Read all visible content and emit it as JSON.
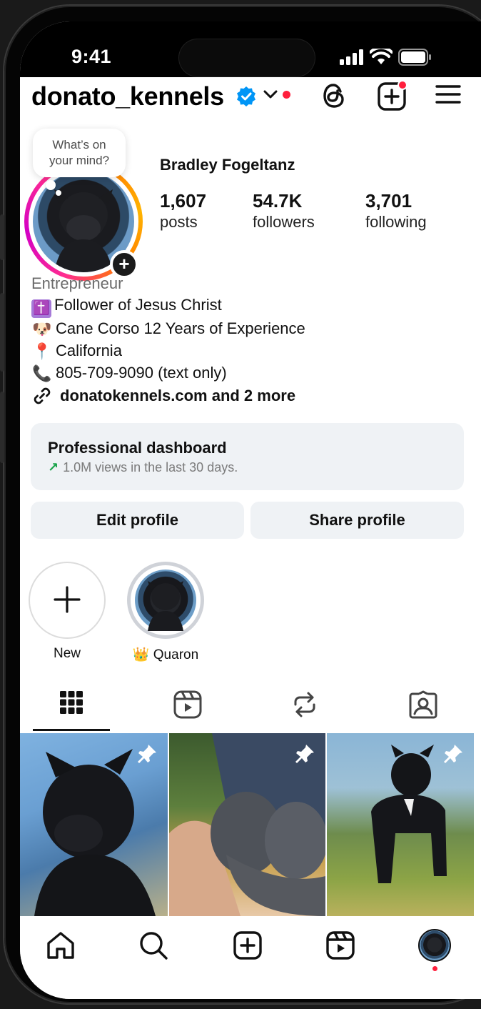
{
  "status_bar": {
    "time": "9:41"
  },
  "header": {
    "username": "donato_kennels"
  },
  "profile": {
    "note_line1": "What’s on",
    "note_line2": "your mind?",
    "full_name": "Bradley Fogeltanz",
    "stats": [
      {
        "value": "1,607",
        "label": "posts"
      },
      {
        "value": "54.7K",
        "label": "followers"
      },
      {
        "value": "3,701",
        "label": "following"
      }
    ],
    "category": "Entrepreneur",
    "bio_lines": [
      {
        "emoji": "✝️",
        "text": "Follower of Jesus Christ"
      },
      {
        "emoji": "🐶",
        "text": "Cane Corso 12 Years of Experience"
      },
      {
        "emoji": "📍",
        "text": "California"
      },
      {
        "emoji": "📞",
        "text": "805-709-9090 (text only)"
      }
    ],
    "link": "donatokennels.com and 2 more"
  },
  "dashboard": {
    "title": "Professional dashboard",
    "arrow": "↗",
    "subtitle": "1.0M views in the last 30 days."
  },
  "buttons": {
    "edit": "Edit profile",
    "share": "Share profile"
  },
  "highlights": {
    "new_label": "New",
    "story_emoji": "👑",
    "story_label": "Quaron"
  },
  "colors": {
    "accent_blue": "#0095f6",
    "notification_red": "#ff1f3d",
    "button_bg": "#eff2f5",
    "trend_green": "#1aa34a"
  },
  "icons": {
    "header": [
      "verified-icon",
      "chevron-down-icon",
      "threads-icon",
      "new-post-icon",
      "menu-icon"
    ],
    "tabs": [
      "grid-icon",
      "reels-icon",
      "reposts-icon",
      "tagged-icon"
    ],
    "nav": [
      "home-icon",
      "search-icon",
      "create-icon",
      "reels-icon",
      "profile-avatar"
    ]
  }
}
